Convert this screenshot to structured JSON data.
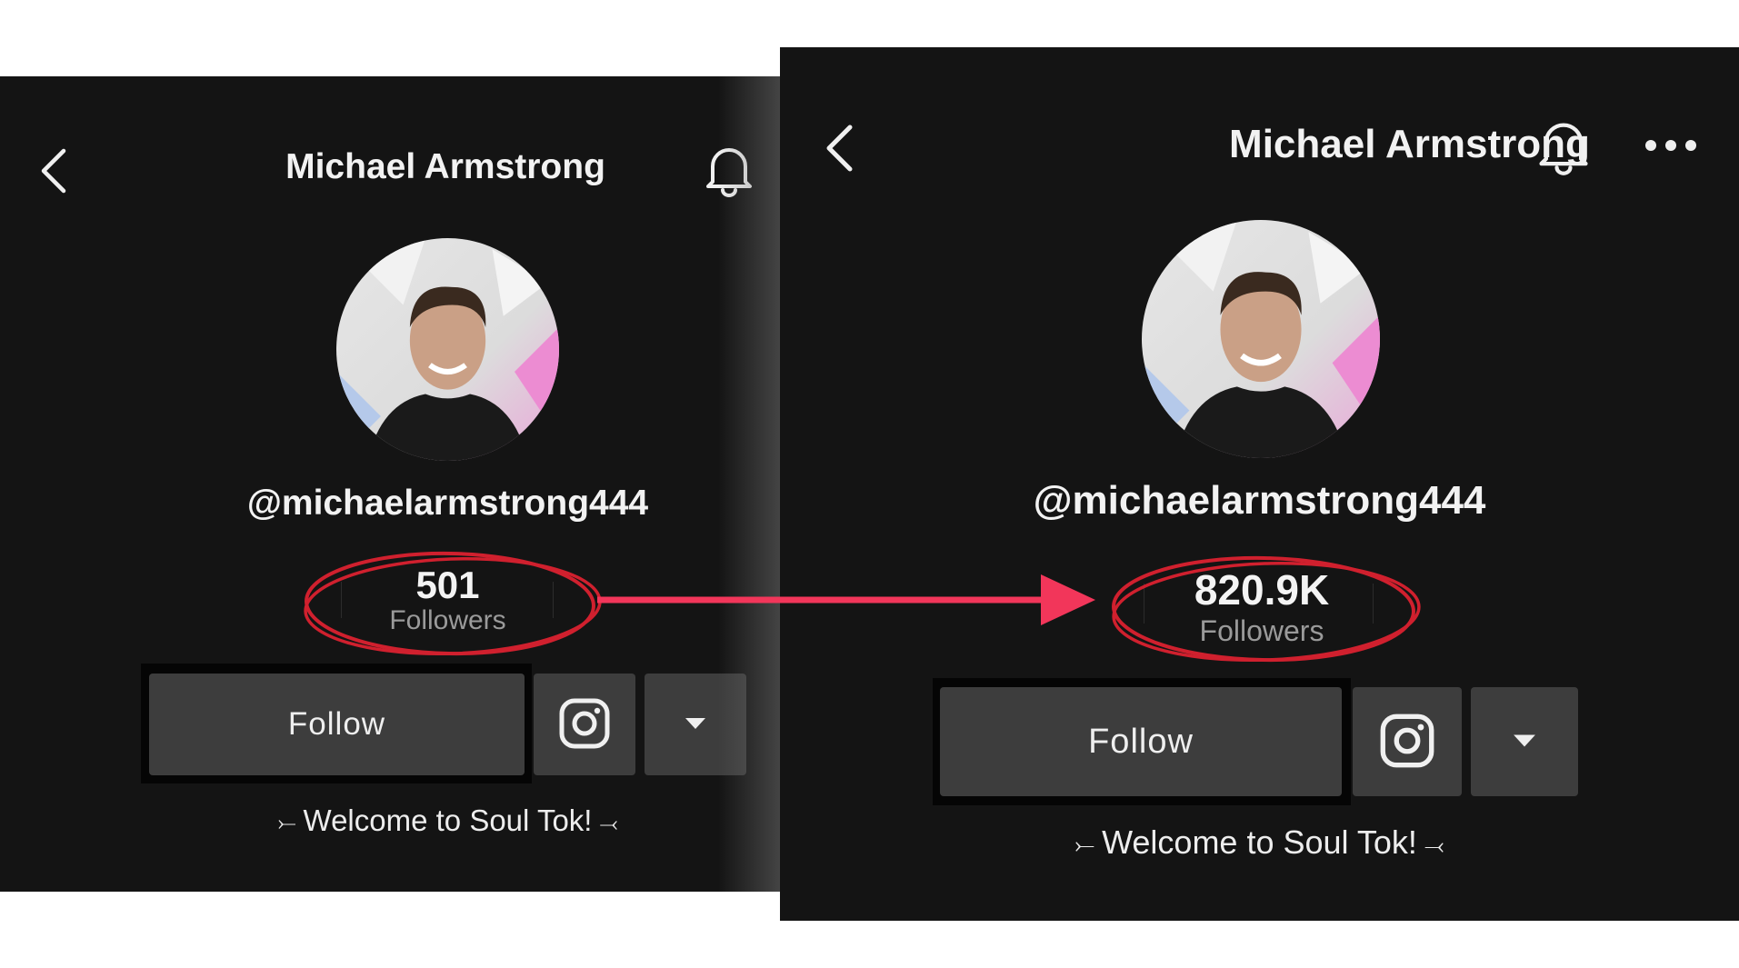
{
  "colors": {
    "panel_bg": "#141414",
    "button_bg": "#3d3d3d",
    "highlight_red": "#d0202e",
    "arrow_pink": "#f2365a"
  },
  "icons": {
    "back": "chevron-left-icon",
    "notifications": "bell-icon",
    "more": "ellipsis-icon",
    "instagram": "instagram-icon",
    "dropdown": "caret-down-icon"
  },
  "before": {
    "title": "Michael Armstrong",
    "username": "@michaelarmstrong444",
    "followers_count": "501",
    "followers_label": "Followers",
    "follow_label": "Follow",
    "bio_text": "Welcome to Soul Tok!",
    "bio_left_ornament": "⤚",
    "bio_right_ornament": "⤙"
  },
  "after": {
    "title": "Michael Armstrong",
    "username": "@michaelarmstrong444",
    "followers_count": "820.9K",
    "followers_label": "Followers",
    "follow_label": "Follow",
    "bio_text": "Welcome to Soul Tok!",
    "bio_left_ornament": "⤚",
    "bio_right_ornament": "⤙"
  }
}
